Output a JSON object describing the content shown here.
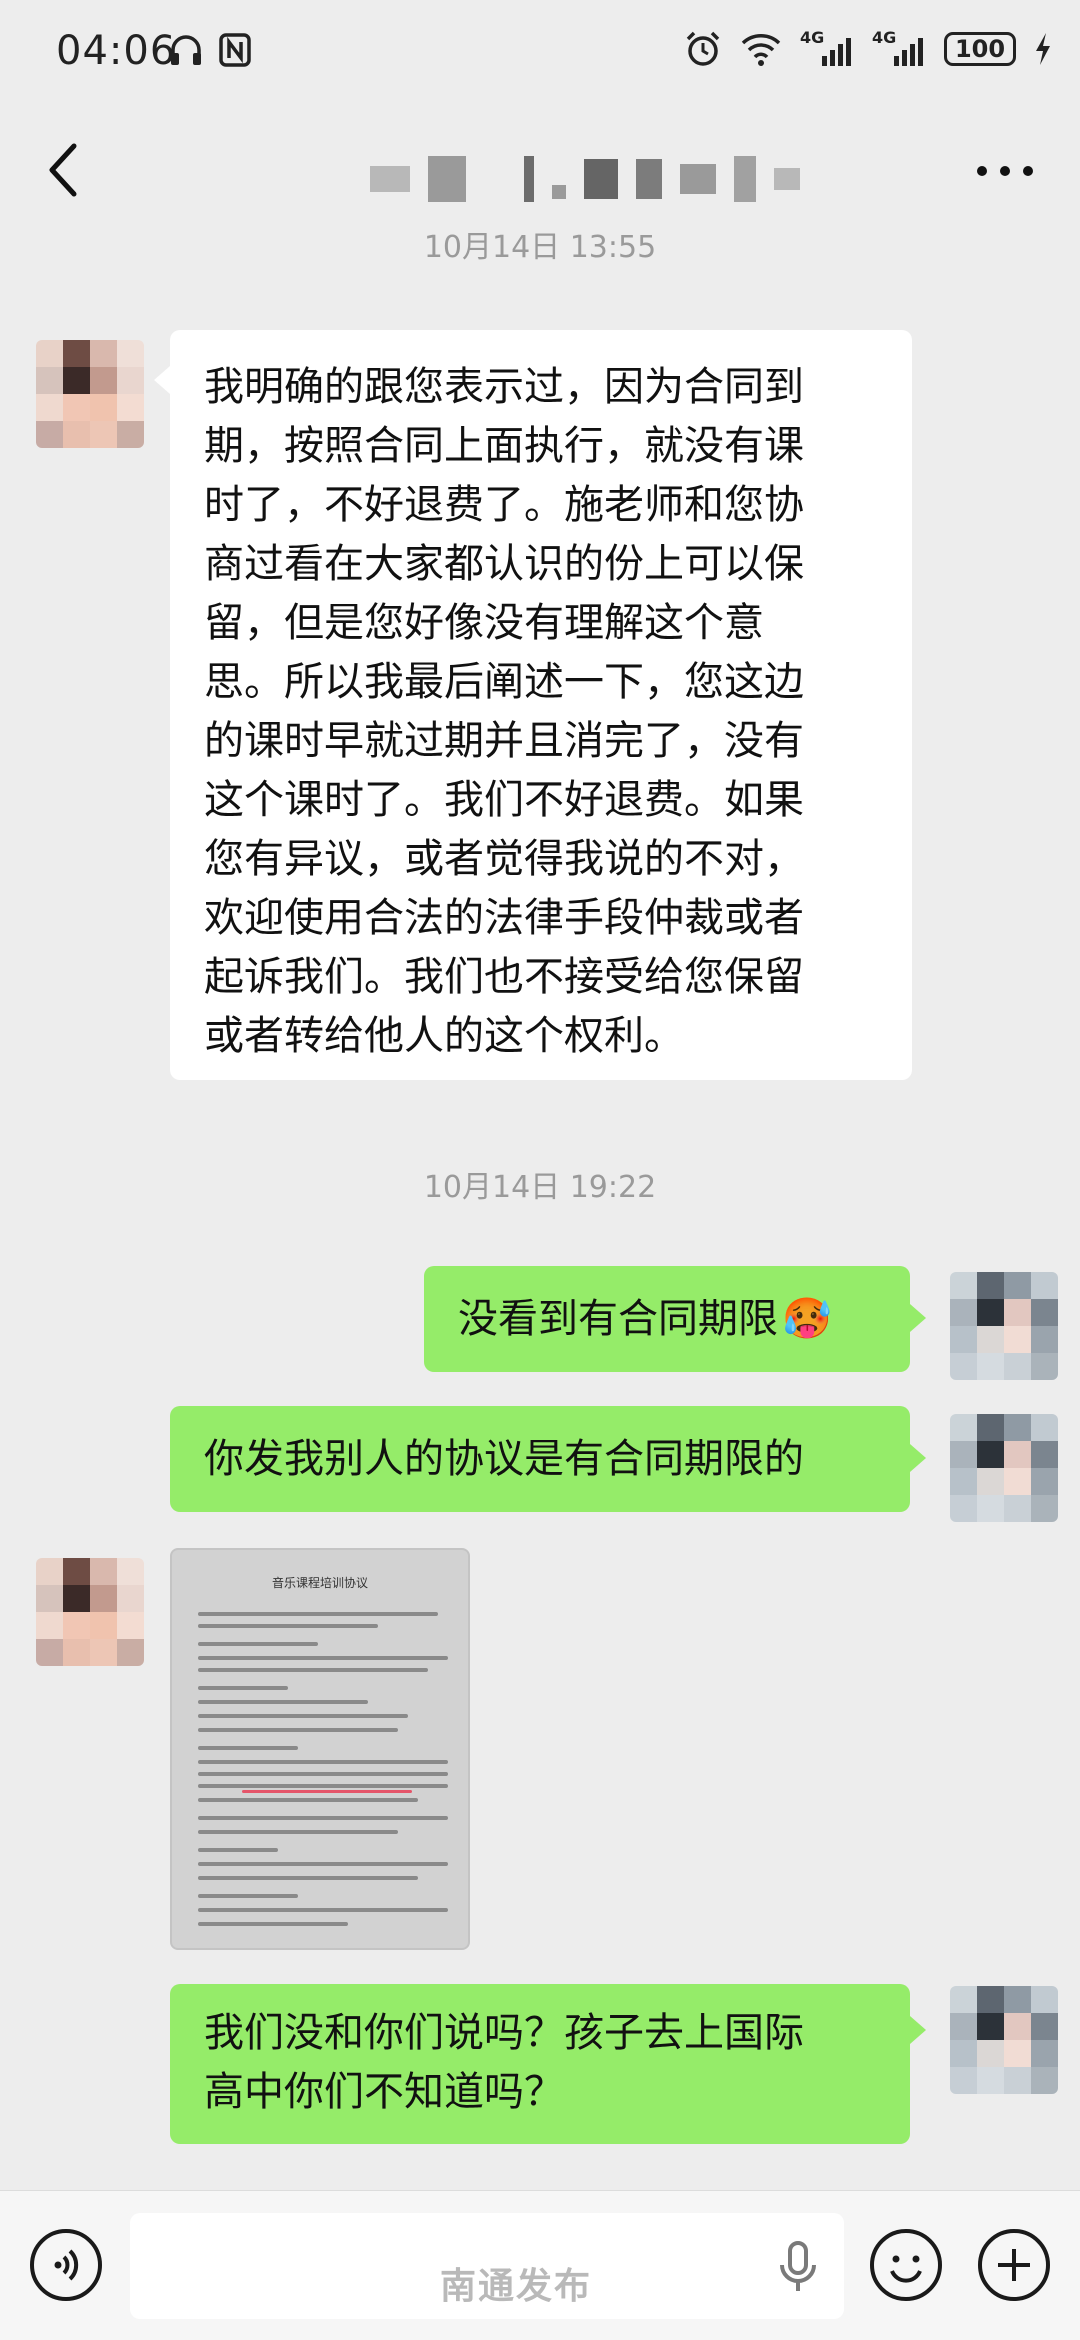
{
  "status_bar": {
    "time": "04:06",
    "battery": "100",
    "network1": "4G",
    "network2": "4G"
  },
  "header": {
    "title_blurred": true
  },
  "messages": [
    {
      "type": "timestamp",
      "text": "10月14日 13:55"
    },
    {
      "type": "text",
      "side": "in",
      "lines": [
        "我明确的跟您表示过，因为合同到",
        "期，按照合同上面执行，就没有课",
        "时了，不好退费了。施老师和您协",
        "商过看在大家都认识的份上可以保",
        "留，但是您好像没有理解这个意",
        "思。所以我最后阐述一下，您这边",
        "的课时早就过期并且消完了，没有",
        "这个课时了。我们不好退费。如果",
        "您有异议，或者觉得我说的不对，",
        "欢迎使用合法的法律手段仲裁或者",
        "起诉我们。我们也不接受给您保留",
        "或者转给他人的这个权利。"
      ]
    },
    {
      "type": "timestamp",
      "text": "10月14日 19:22"
    },
    {
      "type": "text",
      "side": "out",
      "text": "没看到有合同期限",
      "emoji": "🥵"
    },
    {
      "type": "text",
      "side": "out",
      "text": "你发我别人的协议是有合同期限的"
    },
    {
      "type": "image",
      "side": "in",
      "doc_title": "音乐课程培训协议"
    },
    {
      "type": "text",
      "side": "out",
      "lines": [
        "我们没和你们说吗？孩子去上国际",
        "高中你们不知道吗？"
      ]
    }
  ],
  "input_bar": {
    "watermark": "南通发布"
  },
  "colors": {
    "background": "#ededed",
    "bubble_out": "#95ec69",
    "bubble_in": "#ffffff",
    "timestamp": "#9a9a9a"
  }
}
